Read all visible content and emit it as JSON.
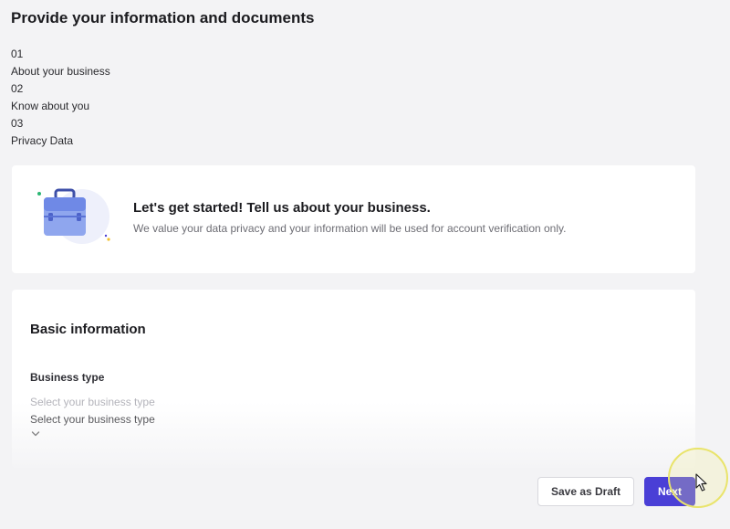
{
  "page": {
    "title": "Provide your information and documents"
  },
  "steps": [
    {
      "number": "01",
      "label": "About your business"
    },
    {
      "number": "02",
      "label": "Know about you"
    },
    {
      "number": "03",
      "label": "Privacy Data"
    }
  ],
  "intro": {
    "illustration": "briefcase-icon",
    "title": "Let's get started! Tell us about your business.",
    "subtitle": "We value your data privacy and your information will be used for account verification only."
  },
  "form": {
    "section_title": "Basic information",
    "business_type": {
      "label": "Business type",
      "placeholder": "Select your business type",
      "selected": "Select your business type",
      "dropdown_icon": "chevron-down-icon"
    }
  },
  "actions": {
    "save_draft_label": "Save as Draft",
    "next_label": "Next"
  },
  "colors": {
    "background": "#f3f3f5",
    "primary": "#4a3fd6",
    "cursor_highlight": "#e9e46b"
  }
}
